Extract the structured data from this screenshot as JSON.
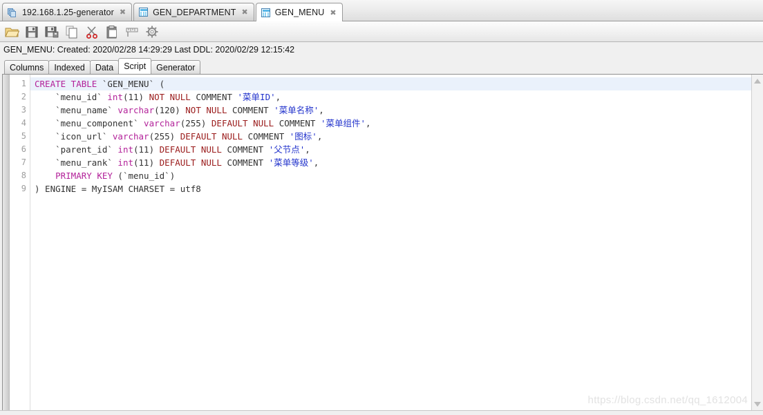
{
  "window": {
    "tabs": [
      {
        "label": "192.168.1.25-generator",
        "icon": "database-stack-icon",
        "active": false,
        "closable": true
      },
      {
        "label": "GEN_DEPARTMENT",
        "icon": "table-grid-icon",
        "active": false,
        "closable": true
      },
      {
        "label": "GEN_MENU",
        "icon": "table-grid-icon",
        "active": true,
        "closable": true
      }
    ],
    "close_glyph": "✖"
  },
  "toolbar": {
    "buttons": [
      {
        "name": "open-icon",
        "title": "Open"
      },
      {
        "name": "save-icon",
        "title": "Save"
      },
      {
        "name": "save-as-icon",
        "title": "Save As"
      },
      {
        "name": "copy-icon",
        "title": "Copy"
      },
      {
        "name": "cut-icon",
        "title": "Cut"
      },
      {
        "name": "paste-icon",
        "title": "Paste"
      },
      {
        "name": "format-ruler-icon",
        "title": "Format"
      },
      {
        "name": "settings-gear-icon",
        "title": "Settings"
      }
    ]
  },
  "info": {
    "text": "GEN_MENU: Created: 2020/02/28 14:29:29  Last DDL: 2020/02/29 12:15:42",
    "table_name": "GEN_MENU",
    "created_label": "Created:",
    "created_value": "2020/02/28 14:29:29",
    "last_ddl_label": "Last DDL:",
    "last_ddl_value": "2020/02/29 12:15:42"
  },
  "subtabs": [
    {
      "label": "Columns",
      "active": false
    },
    {
      "label": "Indexed",
      "active": false
    },
    {
      "label": "Data",
      "active": false
    },
    {
      "label": "Script",
      "active": true
    },
    {
      "label": "Generator",
      "active": false
    }
  ],
  "editor": {
    "line_numbers": [
      "1",
      "2",
      "3",
      "4",
      "5",
      "6",
      "7",
      "8",
      "9"
    ],
    "current_line": 1,
    "lines": [
      [
        {
          "t": "CREATE TABLE",
          "c": "k"
        },
        {
          "t": " `GEN_MENU` (",
          "c": "id"
        }
      ],
      [
        {
          "t": "    `menu_id` ",
          "c": "id"
        },
        {
          "t": "int",
          "c": "k"
        },
        {
          "t": "(11) ",
          "c": "id"
        },
        {
          "t": "NOT NULL",
          "c": "kd"
        },
        {
          "t": " COMMENT ",
          "c": "id"
        },
        {
          "t": "'菜单ID'",
          "c": "str"
        },
        {
          "t": ",",
          "c": "id"
        }
      ],
      [
        {
          "t": "    `menu_name` ",
          "c": "id"
        },
        {
          "t": "varchar",
          "c": "k"
        },
        {
          "t": "(120) ",
          "c": "id"
        },
        {
          "t": "NOT NULL",
          "c": "kd"
        },
        {
          "t": " COMMENT ",
          "c": "id"
        },
        {
          "t": "'菜单名称'",
          "c": "str"
        },
        {
          "t": ",",
          "c": "id"
        }
      ],
      [
        {
          "t": "    `menu_component` ",
          "c": "id"
        },
        {
          "t": "varchar",
          "c": "k"
        },
        {
          "t": "(255) ",
          "c": "id"
        },
        {
          "t": "DEFAULT NULL",
          "c": "kd"
        },
        {
          "t": " COMMENT ",
          "c": "id"
        },
        {
          "t": "'菜单组件'",
          "c": "str"
        },
        {
          "t": ",",
          "c": "id"
        }
      ],
      [
        {
          "t": "    `icon_url` ",
          "c": "id"
        },
        {
          "t": "varchar",
          "c": "k"
        },
        {
          "t": "(255) ",
          "c": "id"
        },
        {
          "t": "DEFAULT NULL",
          "c": "kd"
        },
        {
          "t": " COMMENT ",
          "c": "id"
        },
        {
          "t": "'图标'",
          "c": "str"
        },
        {
          "t": ",",
          "c": "id"
        }
      ],
      [
        {
          "t": "    `parent_id` ",
          "c": "id"
        },
        {
          "t": "int",
          "c": "k"
        },
        {
          "t": "(11) ",
          "c": "id"
        },
        {
          "t": "DEFAULT NULL",
          "c": "kd"
        },
        {
          "t": " COMMENT ",
          "c": "id"
        },
        {
          "t": "'父节点'",
          "c": "str"
        },
        {
          "t": ",",
          "c": "id"
        }
      ],
      [
        {
          "t": "    `menu_rank` ",
          "c": "id"
        },
        {
          "t": "int",
          "c": "k"
        },
        {
          "t": "(11) ",
          "c": "id"
        },
        {
          "t": "DEFAULT NULL",
          "c": "kd"
        },
        {
          "t": " COMMENT ",
          "c": "id"
        },
        {
          "t": "'菜单等级'",
          "c": "str"
        },
        {
          "t": ",",
          "c": "id"
        }
      ],
      [
        {
          "t": "    ",
          "c": "id"
        },
        {
          "t": "PRIMARY KEY",
          "c": "k"
        },
        {
          "t": " (`menu_id`)",
          "c": "id"
        }
      ],
      [
        {
          "t": ") ENGINE = MyISAM CHARSET = utf8",
          "c": "id"
        }
      ]
    ],
    "raw_sql": "CREATE TABLE `GEN_MENU` (\n    `menu_id` int(11) NOT NULL COMMENT '菜单ID',\n    `menu_name` varchar(120) NOT NULL COMMENT '菜单名称',\n    `menu_component` varchar(255) DEFAULT NULL COMMENT '菜单组件',\n    `icon_url` varchar(255) DEFAULT NULL COMMENT '图标',\n    `parent_id` int(11) DEFAULT NULL COMMENT '父节点',\n    `menu_rank` int(11) DEFAULT NULL COMMENT '菜单等级',\n    PRIMARY KEY (`menu_id`)\n) ENGINE = MyISAM CHARSET = utf8"
  },
  "scrollbar": {
    "up_arrow": "▲",
    "down_arrow": "▼"
  },
  "watermark": {
    "text": "https://blog.csdn.net/qq_1612004"
  },
  "colors": {
    "keyword": "#b3229a",
    "keyword_dark": "#9a1b1b",
    "string": "#2233cc",
    "identifier": "#333333",
    "current_line_bg": "#eaf1fb",
    "chrome_bg": "#f0f0f0"
  }
}
